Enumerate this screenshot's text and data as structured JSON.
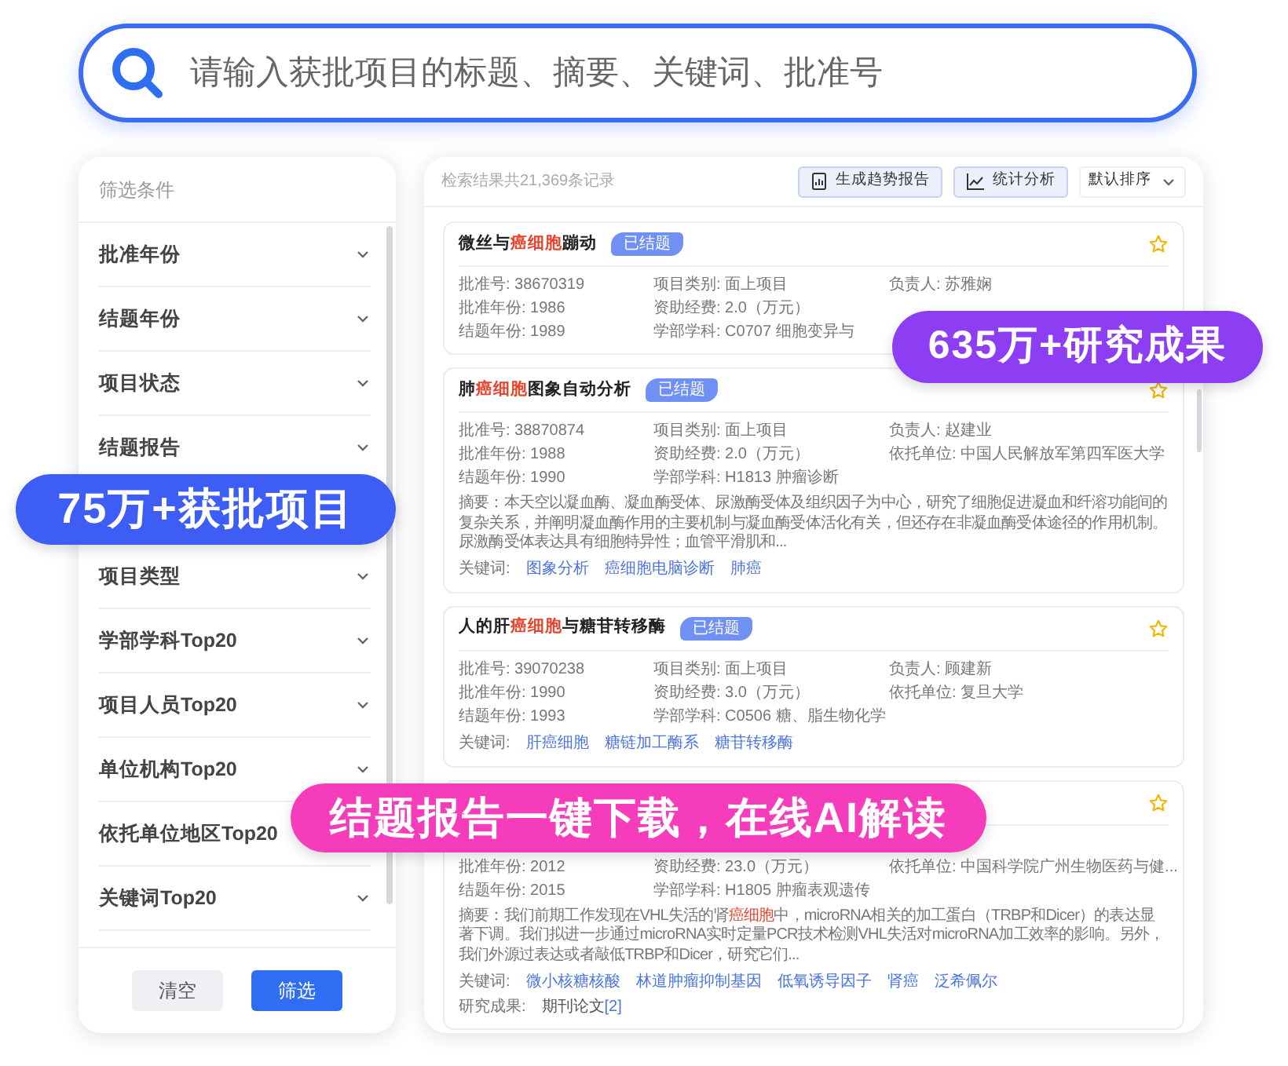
{
  "search": {
    "placeholder": "请输入获批项目的标题、摘要、关键词、批准号"
  },
  "sidebar": {
    "title": "筛选条件",
    "items": [
      {
        "label": "批准年份",
        "chevron": true
      },
      {
        "label": "结题年份",
        "chevron": true
      },
      {
        "label": "项目状态",
        "chevron": true
      },
      {
        "label": "结题报告",
        "chevron": true
      },
      {
        "label": "项目类型",
        "chevron": true
      },
      {
        "label": "学部学科Top20",
        "chevron": true
      },
      {
        "label": "项目人员Top20",
        "chevron": true
      },
      {
        "label": "单位机构Top20",
        "chevron": true
      },
      {
        "label": "依托单位地区Top20",
        "chevron": false
      },
      {
        "label": "关键词Top20",
        "chevron": true
      }
    ],
    "buttons": [
      {
        "label": "清空",
        "kind": "secondary"
      },
      {
        "label": "筛选",
        "kind": "primary"
      }
    ]
  },
  "results": {
    "summary": "检索结果共21,369条记录",
    "actions": [
      {
        "label": "生成趋势报告",
        "kind": "report"
      },
      {
        "label": "统计分析",
        "kind": "chart"
      }
    ],
    "sort": "默认排序",
    "cards": [
      {
        "title": [
          {
            "text": "微丝与",
            "highlight": false
          },
          {
            "text": "癌细胞",
            "highlight": true
          },
          {
            "text": "蹦动",
            "highlight": false
          }
        ],
        "status": "已结题",
        "fields": [
          [
            "批准号: 38670319",
            "项目类别: 面上项目",
            "负责人: 苏雅娴"
          ],
          [
            "批准年份: 1986",
            "资助经费: 2.0（万元）"
          ],
          [
            "结题年份: 1989",
            "学部学科: C0707 细胞变异与"
          ]
        ]
      },
      {
        "title": [
          {
            "text": "肺",
            "highlight": false
          },
          {
            "text": "癌细胞",
            "highlight": true
          },
          {
            "text": "图象自动分析",
            "highlight": false
          }
        ],
        "status": "已结题",
        "fields": [
          [
            "批准号: 38870874",
            "项目类别: 面上项目",
            "负责人: 赵建业"
          ],
          [
            "批准年份: 1988",
            "资助经费: 2.0（万元）",
            "依托单位: 中国人民解放军第四军医大学"
          ],
          [
            "结题年份: 1990",
            "学部学科: H1813 肿瘤诊断"
          ]
        ],
        "abstract": [
          {
            "text": "摘要：本天空以凝血酶、凝血酶受体、尿激酶受体及组织因子为中心，研究了细胞促进凝血和纤溶功能间的复杂关系，并阐明凝血酶作用的主要机制与凝血酶受体活化有关，但还存在非凝血酶受体途径的作用机制。尿激酶受体表达具有细胞特异性；血管平滑肌和...",
            "highlight": false
          }
        ],
        "keywords_label": "关键词:",
        "keywords": [
          "图象分析",
          "癌细胞电脑诊断",
          "肺癌"
        ]
      },
      {
        "title": [
          {
            "text": "人的肝",
            "highlight": false
          },
          {
            "text": "癌细胞",
            "highlight": true
          },
          {
            "text": "与糖苷转移酶",
            "highlight": false
          }
        ],
        "status": "已结题",
        "fields": [
          [
            "批准号: 39070238",
            "项目类别: 面上项目",
            "负责人: 顾建新"
          ],
          [
            "批准年份: 1990",
            "资助经费: 3.0（万元）",
            "依托单位: 复旦大学"
          ],
          [
            "结题年份: 1993",
            "学部学科: C0506 糖、脂生物化学"
          ]
        ],
        "keywords_label": "关键词:",
        "keywords": [
          "肝癌细胞",
          "糖链加工酶系",
          "糖苷转移酶"
        ]
      },
      {
        "fields": [
          [
            "批准年份: 2012",
            "资助经费: 23.0（万元）",
            "依托单位: 中国科学院广州生物医药与健..."
          ],
          [
            "结题年份: 2015",
            "学部学科: H1805 肿瘤表观遗传"
          ]
        ],
        "abstract": [
          {
            "text": "摘要：我们前期工作发现在VHL失活的肾",
            "highlight": false
          },
          {
            "text": "癌细胞",
            "highlight": true
          },
          {
            "text": "中，microRNA相关的加工蛋白（TRBP和Dicer）的表达显著下调。我们拟进一步通过microRNA实时定量PCR技术检测VHL失活对microRNA加工效率的影响。另外，我们外源过表达或者敲低TRBP和Dicer，研究它们...",
            "highlight": false
          }
        ],
        "keywords_label": "关键词:",
        "keywords": [
          "微小核糖核酸",
          "林道肿瘤抑制基因",
          "低氧诱导因子",
          "肾癌",
          "泛希佩尔"
        ],
        "outcome_label": "研究成果:",
        "outcome": "期刊论文",
        "outcome_count": "[2]"
      }
    ]
  },
  "banners": [
    {
      "text": "75万+获批项目",
      "color": "#3d5df5"
    },
    {
      "text": "635万+研究成果",
      "color": "#8d3ef2"
    },
    {
      "text": "结题报告一键下载，在线AI解读",
      "color": "#f53cba"
    }
  ]
}
